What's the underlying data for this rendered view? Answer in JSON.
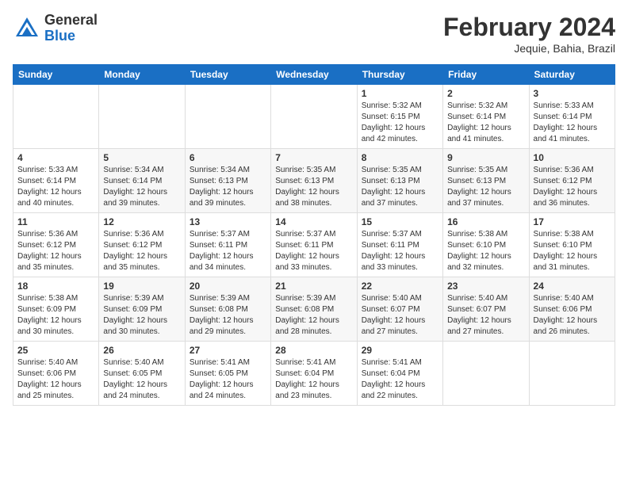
{
  "header": {
    "logo_general": "General",
    "logo_blue": "Blue",
    "month_year": "February 2024",
    "location": "Jequie, Bahia, Brazil"
  },
  "days_of_week": [
    "Sunday",
    "Monday",
    "Tuesday",
    "Wednesday",
    "Thursday",
    "Friday",
    "Saturday"
  ],
  "weeks": [
    [
      {
        "day": "",
        "sunrise": "",
        "sunset": "",
        "daylight": ""
      },
      {
        "day": "",
        "sunrise": "",
        "sunset": "",
        "daylight": ""
      },
      {
        "day": "",
        "sunrise": "",
        "sunset": "",
        "daylight": ""
      },
      {
        "day": "",
        "sunrise": "",
        "sunset": "",
        "daylight": ""
      },
      {
        "day": "1",
        "sunrise": "Sunrise: 5:32 AM",
        "sunset": "Sunset: 6:15 PM",
        "daylight": "Daylight: 12 hours and 42 minutes."
      },
      {
        "day": "2",
        "sunrise": "Sunrise: 5:32 AM",
        "sunset": "Sunset: 6:14 PM",
        "daylight": "Daylight: 12 hours and 41 minutes."
      },
      {
        "day": "3",
        "sunrise": "Sunrise: 5:33 AM",
        "sunset": "Sunset: 6:14 PM",
        "daylight": "Daylight: 12 hours and 41 minutes."
      }
    ],
    [
      {
        "day": "4",
        "sunrise": "Sunrise: 5:33 AM",
        "sunset": "Sunset: 6:14 PM",
        "daylight": "Daylight: 12 hours and 40 minutes."
      },
      {
        "day": "5",
        "sunrise": "Sunrise: 5:34 AM",
        "sunset": "Sunset: 6:14 PM",
        "daylight": "Daylight: 12 hours and 39 minutes."
      },
      {
        "day": "6",
        "sunrise": "Sunrise: 5:34 AM",
        "sunset": "Sunset: 6:13 PM",
        "daylight": "Daylight: 12 hours and 39 minutes."
      },
      {
        "day": "7",
        "sunrise": "Sunrise: 5:35 AM",
        "sunset": "Sunset: 6:13 PM",
        "daylight": "Daylight: 12 hours and 38 minutes."
      },
      {
        "day": "8",
        "sunrise": "Sunrise: 5:35 AM",
        "sunset": "Sunset: 6:13 PM",
        "daylight": "Daylight: 12 hours and 37 minutes."
      },
      {
        "day": "9",
        "sunrise": "Sunrise: 5:35 AM",
        "sunset": "Sunset: 6:13 PM",
        "daylight": "Daylight: 12 hours and 37 minutes."
      },
      {
        "day": "10",
        "sunrise": "Sunrise: 5:36 AM",
        "sunset": "Sunset: 6:12 PM",
        "daylight": "Daylight: 12 hours and 36 minutes."
      }
    ],
    [
      {
        "day": "11",
        "sunrise": "Sunrise: 5:36 AM",
        "sunset": "Sunset: 6:12 PM",
        "daylight": "Daylight: 12 hours and 35 minutes."
      },
      {
        "day": "12",
        "sunrise": "Sunrise: 5:36 AM",
        "sunset": "Sunset: 6:12 PM",
        "daylight": "Daylight: 12 hours and 35 minutes."
      },
      {
        "day": "13",
        "sunrise": "Sunrise: 5:37 AM",
        "sunset": "Sunset: 6:11 PM",
        "daylight": "Daylight: 12 hours and 34 minutes."
      },
      {
        "day": "14",
        "sunrise": "Sunrise: 5:37 AM",
        "sunset": "Sunset: 6:11 PM",
        "daylight": "Daylight: 12 hours and 33 minutes."
      },
      {
        "day": "15",
        "sunrise": "Sunrise: 5:37 AM",
        "sunset": "Sunset: 6:11 PM",
        "daylight": "Daylight: 12 hours and 33 minutes."
      },
      {
        "day": "16",
        "sunrise": "Sunrise: 5:38 AM",
        "sunset": "Sunset: 6:10 PM",
        "daylight": "Daylight: 12 hours and 32 minutes."
      },
      {
        "day": "17",
        "sunrise": "Sunrise: 5:38 AM",
        "sunset": "Sunset: 6:10 PM",
        "daylight": "Daylight: 12 hours and 31 minutes."
      }
    ],
    [
      {
        "day": "18",
        "sunrise": "Sunrise: 5:38 AM",
        "sunset": "Sunset: 6:09 PM",
        "daylight": "Daylight: 12 hours and 30 minutes."
      },
      {
        "day": "19",
        "sunrise": "Sunrise: 5:39 AM",
        "sunset": "Sunset: 6:09 PM",
        "daylight": "Daylight: 12 hours and 30 minutes."
      },
      {
        "day": "20",
        "sunrise": "Sunrise: 5:39 AM",
        "sunset": "Sunset: 6:08 PM",
        "daylight": "Daylight: 12 hours and 29 minutes."
      },
      {
        "day": "21",
        "sunrise": "Sunrise: 5:39 AM",
        "sunset": "Sunset: 6:08 PM",
        "daylight": "Daylight: 12 hours and 28 minutes."
      },
      {
        "day": "22",
        "sunrise": "Sunrise: 5:40 AM",
        "sunset": "Sunset: 6:07 PM",
        "daylight": "Daylight: 12 hours and 27 minutes."
      },
      {
        "day": "23",
        "sunrise": "Sunrise: 5:40 AM",
        "sunset": "Sunset: 6:07 PM",
        "daylight": "Daylight: 12 hours and 27 minutes."
      },
      {
        "day": "24",
        "sunrise": "Sunrise: 5:40 AM",
        "sunset": "Sunset: 6:06 PM",
        "daylight": "Daylight: 12 hours and 26 minutes."
      }
    ],
    [
      {
        "day": "25",
        "sunrise": "Sunrise: 5:40 AM",
        "sunset": "Sunset: 6:06 PM",
        "daylight": "Daylight: 12 hours and 25 minutes."
      },
      {
        "day": "26",
        "sunrise": "Sunrise: 5:40 AM",
        "sunset": "Sunset: 6:05 PM",
        "daylight": "Daylight: 12 hours and 24 minutes."
      },
      {
        "day": "27",
        "sunrise": "Sunrise: 5:41 AM",
        "sunset": "Sunset: 6:05 PM",
        "daylight": "Daylight: 12 hours and 24 minutes."
      },
      {
        "day": "28",
        "sunrise": "Sunrise: 5:41 AM",
        "sunset": "Sunset: 6:04 PM",
        "daylight": "Daylight: 12 hours and 23 minutes."
      },
      {
        "day": "29",
        "sunrise": "Sunrise: 5:41 AM",
        "sunset": "Sunset: 6:04 PM",
        "daylight": "Daylight: 12 hours and 22 minutes."
      },
      {
        "day": "",
        "sunrise": "",
        "sunset": "",
        "daylight": ""
      },
      {
        "day": "",
        "sunrise": "",
        "sunset": "",
        "daylight": ""
      }
    ]
  ]
}
